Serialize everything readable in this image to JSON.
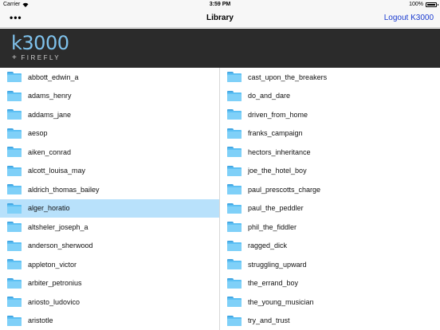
{
  "status": {
    "carrier": "Carrier",
    "time": "3:59 PM",
    "battery": "100%",
    "battery_level": 1.0
  },
  "nav": {
    "title": "Library",
    "menu_label": "•••",
    "logout_label": "Logout K3000"
  },
  "banner": {
    "logo_text": "k3000",
    "sub_text": "FIREFLY",
    "logo_color": "#7fc2ec"
  },
  "colors": {
    "selected_row": "#b8e1fb",
    "folder": "#5cc0f4",
    "link": "#1a3bd0"
  },
  "left_items": [
    "abbott_edwin_a",
    "adams_henry",
    "addams_jane",
    "aesop",
    "aiken_conrad",
    "alcott_louisa_may",
    "aldrich_thomas_bailey",
    "alger_horatio",
    "altsheler_joseph_a",
    "anderson_sherwood",
    "appleton_victor",
    "arbiter_petronius",
    "ariosto_ludovico",
    "aristotle"
  ],
  "right_items": [
    "cast_upon_the_breakers",
    "do_and_dare",
    "driven_from_home",
    "franks_campaign",
    "hectors_inheritance",
    "joe_the_hotel_boy",
    "paul_prescotts_charge",
    "paul_the_peddler",
    "phil_the_fiddler",
    "ragged_dick",
    "struggling_upward",
    "the_errand_boy",
    "the_young_musician",
    "try_and_trust"
  ],
  "selected_left": "alger_horatio"
}
